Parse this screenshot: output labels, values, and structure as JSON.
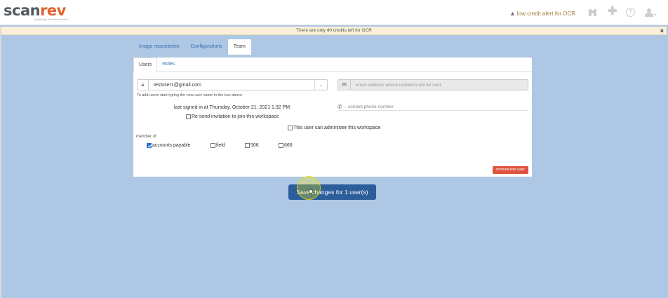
{
  "header": {
    "logo_primary": "scan",
    "logo_accent": "rev",
    "logo_tagline": "scanning Revolutionized",
    "alert_text": "low credit alert for OCR",
    "icons": [
      "warning-icon",
      "binoculars-icon",
      "plus-icon",
      "help-icon",
      "user-icon"
    ]
  },
  "notice": {
    "text": "There are only 40 credits left for OCR",
    "close_label": "×"
  },
  "outer_tabs": [
    "Image repositories",
    "Configurations",
    "Team"
  ],
  "inner_tabs": [
    "Users",
    "Roles"
  ],
  "form": {
    "username_value": "testuser1@gmail.com",
    "username_help": "To add users start typing the new user name in the box above",
    "email_placeholder": "email address where invitation will be sent",
    "phone_placeholder": "contact phone number",
    "signed_in_text": "last signed in at Thursday, October 21, 2021 1:32 PM",
    "resend_label": "Re send invitation to join this workspace",
    "admin_label": "This user can administer this workspace",
    "member_of_label": "member of",
    "groups": [
      {
        "label": "accounts payable",
        "checked": true
      },
      {
        "label": "field",
        "checked": false
      },
      {
        "label": "506",
        "checked": false
      },
      {
        "label": "666",
        "checked": false
      }
    ],
    "remove_label": "remove this user"
  },
  "save_button_label": "Save changes for 1 user(s)",
  "colors": {
    "accent": "#e0622a",
    "background": "#aec7e4",
    "primary_button": "#2c5e9c",
    "danger_button": "#dd5440",
    "link": "#3a6fb0"
  }
}
